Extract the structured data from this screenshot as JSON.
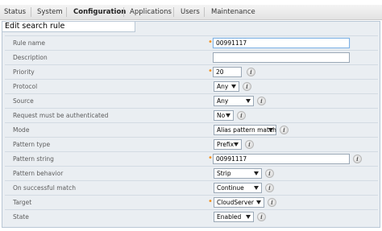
{
  "nav": {
    "items": [
      {
        "label": "Status"
      },
      {
        "label": "System"
      },
      {
        "label": "Configuration"
      },
      {
        "label": "Applications"
      },
      {
        "label": "Users"
      },
      {
        "label": "Maintenance"
      }
    ],
    "active": "Configuration"
  },
  "panel": {
    "title": "Edit search rule"
  },
  "form": {
    "rule_name": {
      "label": "Rule name",
      "value": "00991117",
      "required": true
    },
    "description": {
      "label": "Description",
      "value": ""
    },
    "priority": {
      "label": "Priority",
      "value": "20",
      "required": true
    },
    "protocol": {
      "label": "Protocol",
      "value": "Any"
    },
    "source": {
      "label": "Source",
      "value": "Any"
    },
    "request_auth": {
      "label": "Request must be authenticated",
      "value": "No"
    },
    "mode": {
      "label": "Mode",
      "value": "Alias pattern match"
    },
    "pattern_type": {
      "label": "Pattern type",
      "value": "Prefix"
    },
    "pattern_string": {
      "label": "Pattern string",
      "value": "00991117",
      "required": true
    },
    "pattern_behavior": {
      "label": "Pattern behavior",
      "value": "Strip"
    },
    "on_success": {
      "label": "On successful match",
      "value": "Continue"
    },
    "target": {
      "label": "Target",
      "value": "CloudServer",
      "required": true
    },
    "state": {
      "label": "State",
      "value": "Enabled"
    }
  },
  "icons": {
    "info": "info-icon",
    "required": "required-asterisk"
  },
  "colors": {
    "required": "#f39019",
    "panel_bg": "#eaeef2",
    "border": "#b9c7d5"
  }
}
